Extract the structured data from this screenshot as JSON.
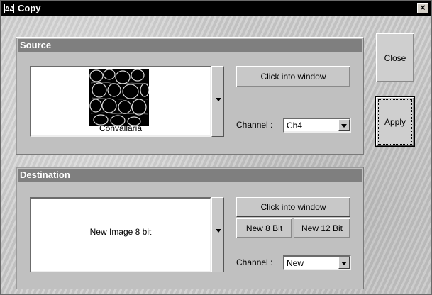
{
  "window": {
    "title": "Copy",
    "close_glyph": "×",
    "icon_glyph": "ΔΔ"
  },
  "source": {
    "header": "Source",
    "thumbnail_caption": "Convallaria",
    "click_into_window_label": "Click into window",
    "channel_label": "Channel :",
    "channel_value": "Ch4"
  },
  "destination": {
    "header": "Destination",
    "image_caption": "New Image 8 bit",
    "click_into_window_label": "Click into window",
    "new_8bit_label": "New 8 Bit",
    "new_12bit_label": "New 12 Bit",
    "channel_label": "Channel :",
    "channel_value": "New"
  },
  "actions": {
    "close_label_first": "C",
    "close_label_rest": "lose",
    "apply_label_first": "A",
    "apply_label_rest": "pply"
  },
  "colors": {
    "title_bar": "#000000",
    "panel_header": "#7f7f7f",
    "panel_bg": "#c0c0c0"
  }
}
